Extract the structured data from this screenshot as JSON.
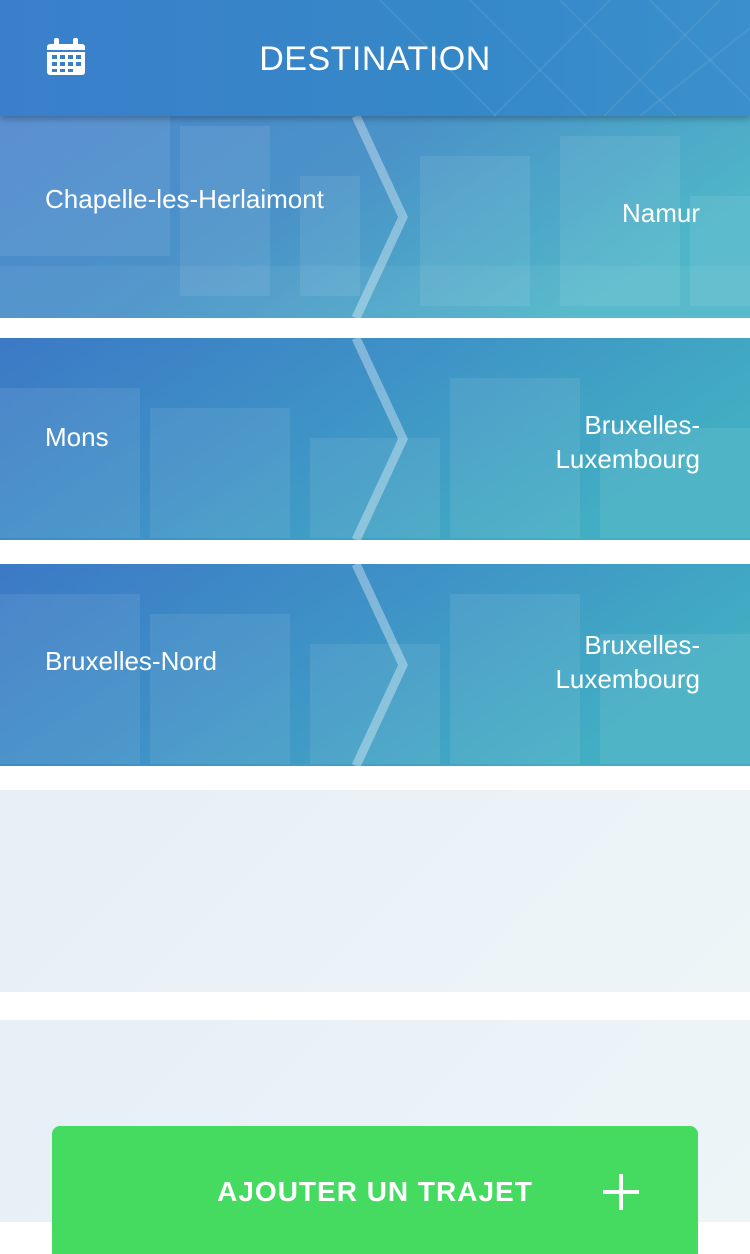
{
  "header": {
    "title": "DESTINATION",
    "calendar_icon": "calendar-icon"
  },
  "routes": [
    {
      "origin": "Chapelle-les-Herlaimont",
      "destination": "Namur"
    },
    {
      "origin": "Mons",
      "destination": "Bruxelles-Luxembourg"
    },
    {
      "origin": "Bruxelles-Nord",
      "destination": "Bruxelles-Luxembourg"
    }
  ],
  "add_button": {
    "label": "AJOUTER UN TRAJET",
    "icon": "plus-icon"
  },
  "colors": {
    "header": "#3a7fca",
    "card_start": "#3c7dc9",
    "card_end": "#3fa8c4",
    "empty_card": "#e9f1f7",
    "add_button": "#45db60",
    "text": "#ffffff"
  }
}
